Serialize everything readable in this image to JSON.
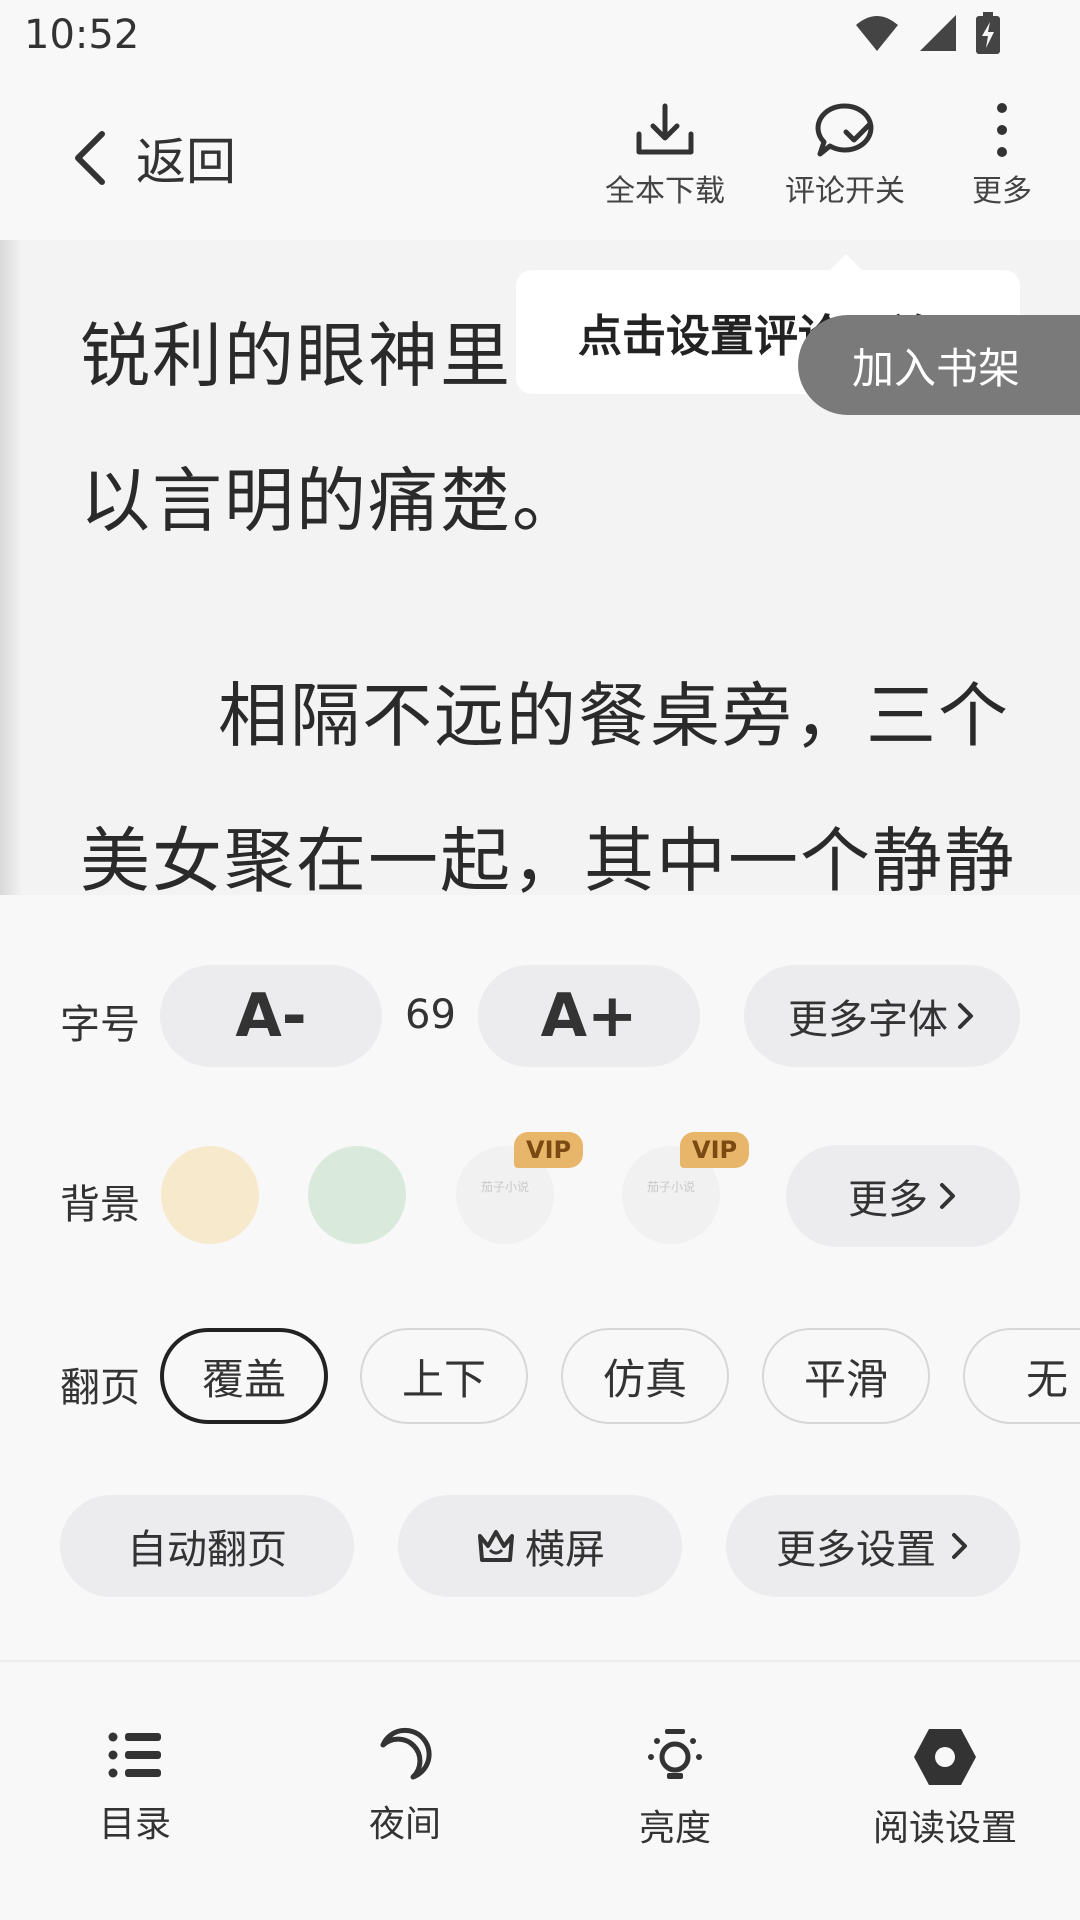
{
  "status": {
    "time": "10:52"
  },
  "toolbar": {
    "back_label": "返回",
    "download_label": "全本下载",
    "comment_label": "评论开关",
    "more_label": "更多"
  },
  "reading": {
    "lines": [
      "锐利的眼神里",
      "以言明的痛楚。",
      "相隔不远的餐桌旁，三个",
      "美女聚在一起，其中一个静静"
    ],
    "tooltip": "点击设置评论开关",
    "add_shelf": "加入书架"
  },
  "font_row": {
    "label": "字号",
    "decrease": "A-",
    "value": "69",
    "increase": "A+",
    "more_fonts": "更多字体"
  },
  "background_row": {
    "label": "背景",
    "swatch_colors": [
      "#f7e9cc",
      "#d9eadc",
      "#f1f1f1",
      "#f1f1f1"
    ],
    "vip_badge": "VIP",
    "swatch_text": "茄子小说",
    "more": "更多"
  },
  "turn_row": {
    "label": "翻页",
    "options": [
      "覆盖",
      "上下",
      "仿真",
      "平滑",
      "无"
    ],
    "selected": "覆盖"
  },
  "actions": {
    "auto_turn": "自动翻页",
    "landscape": "横屏",
    "more_settings": "更多设置"
  },
  "bottom_nav": {
    "items": [
      "目录",
      "夜间",
      "亮度",
      "阅读设置"
    ]
  }
}
